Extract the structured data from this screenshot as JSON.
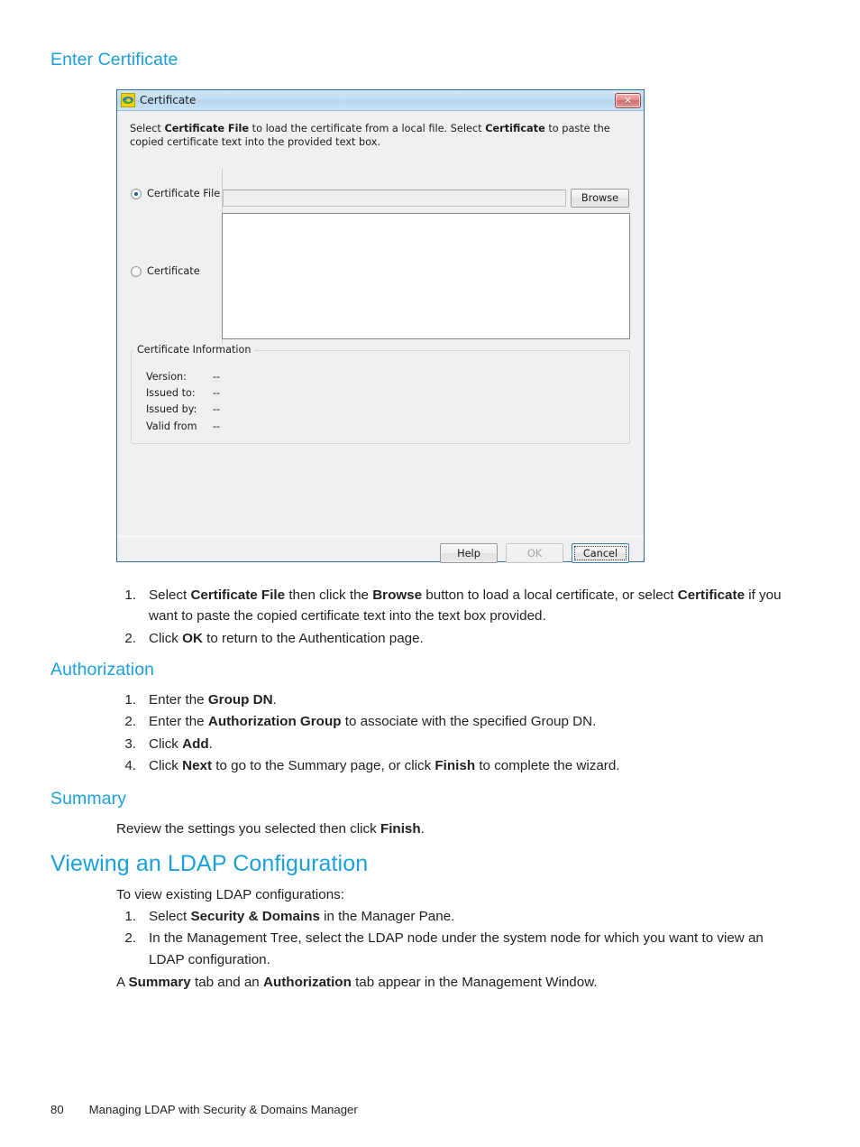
{
  "page": {
    "number": "80",
    "footer_title": "Managing LDAP with Security & Domains Manager"
  },
  "sections": {
    "enter_certificate": {
      "heading": "Enter Certificate",
      "steps": [
        {
          "num": "1.",
          "html": "Select <b>Certificate File</b> then click the <b>Browse</b> button to load a local certificate, or select <b>Certificate</b> if you want to paste the copied certificate text into the text box provided."
        },
        {
          "num": "2.",
          "html": "Click <b>OK</b> to return to the Authentication page."
        }
      ]
    },
    "authorization": {
      "heading": "Authorization",
      "steps": [
        {
          "num": "1.",
          "html": "Enter the <b>Group DN</b>."
        },
        {
          "num": "2.",
          "html": "Enter the <b>Authorization Group</b> to associate with the specified Group DN."
        },
        {
          "num": "3.",
          "html": "Click <b>Add</b>."
        },
        {
          "num": "4.",
          "html": "Click <b>Next</b> to go to the Summary page, or click <b>Finish</b> to complete the wizard."
        }
      ]
    },
    "summary": {
      "heading": "Summary",
      "body_html": "Review the settings you selected then click <b>Finish</b>."
    },
    "viewing_ldap": {
      "heading": "Viewing an LDAP Configuration",
      "intro": "To view existing LDAP configurations:",
      "steps": [
        {
          "num": "1.",
          "html": "Select <b>Security &amp; Domains</b> in the Manager Pane."
        },
        {
          "num": "2.",
          "html": "In the Management Tree, select the LDAP node under the system node for which you want to view an LDAP configuration."
        }
      ],
      "closing_html": "A <b>Summary</b> tab and an <b>Authorization</b> tab appear in the Management Window."
    }
  },
  "dialog": {
    "title": "Certificate",
    "icon": "certificate-recycle-icon",
    "close_label": "✕",
    "description_html": "Select <b>Certificate File</b> to load the certificate from a local file. Select <b>Certificate</b> to paste the copied certificate text into the provided text box.",
    "options": {
      "certificate_file": {
        "label": "Certificate File",
        "selected": true
      },
      "certificate": {
        "label": "Certificate",
        "selected": false
      }
    },
    "path_input": {
      "value": "",
      "placeholder": ""
    },
    "certificate_textarea": {
      "value": "",
      "placeholder": ""
    },
    "browse_button": "Browse",
    "certificate_information": {
      "title": "Certificate Information",
      "rows": [
        {
          "label": "Version:",
          "value": "--"
        },
        {
          "label": "Issued to:",
          "value": "--"
        },
        {
          "label": "Issued by:",
          "value": "--"
        },
        {
          "label": "Valid from",
          "value": "--"
        }
      ]
    },
    "buttons": {
      "help": {
        "label": "Help",
        "state": "enabled"
      },
      "ok": {
        "label": "OK",
        "state": "disabled"
      },
      "cancel": {
        "label": "Cancel",
        "state": "focused"
      }
    }
  },
  "colors": {
    "heading_blue": "#1aa0dc",
    "body_text": "#231f20",
    "dialog_border": "#2e6e9e",
    "dialog_face": "#f0f0f0",
    "close_red": "#cf6a6a",
    "radio_dot": "#1c5da8"
  }
}
